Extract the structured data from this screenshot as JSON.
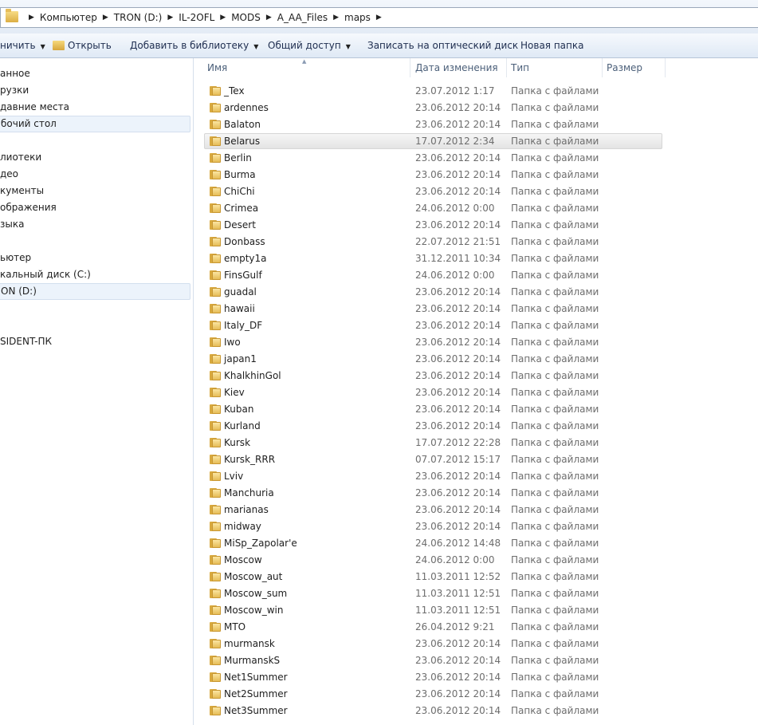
{
  "address_bar": {
    "crumbs": [
      "Компьютер",
      "TRON (D:)",
      "IL-2OFL",
      "MODS",
      "A_AA_Files",
      "maps"
    ]
  },
  "toolbar": {
    "organize": "ничить",
    "open": "Открыть",
    "add_to_library": "Добавить в библиотеку",
    "share": "Общий доступ",
    "burn": "Записать на оптический диск",
    "new_folder": "Новая папка"
  },
  "nav": {
    "items": [
      "анное",
      "рузки",
      "давние места",
      "бочий стол",
      "лиотеки",
      "део",
      "кументы",
      "ображения",
      "зыка",
      "ьютер",
      "кальный диск (C:)",
      "ON (D:)",
      "SIDENT-ПК"
    ]
  },
  "columns": {
    "name": "Имя",
    "date": "Дата изменения",
    "type": "Тип",
    "size": "Размер"
  },
  "files": [
    {
      "name": "_Tex",
      "date": "23.07.2012 1:17",
      "type": "Папка с файлами"
    },
    {
      "name": "ardennes",
      "date": "23.06.2012 20:14",
      "type": "Папка с файлами"
    },
    {
      "name": "Balaton",
      "date": "23.06.2012 20:14",
      "type": "Папка с файлами"
    },
    {
      "name": "Belarus",
      "date": "17.07.2012 2:34",
      "type": "Папка с файлами"
    },
    {
      "name": "Berlin",
      "date": "23.06.2012 20:14",
      "type": "Папка с файлами"
    },
    {
      "name": "Burma",
      "date": "23.06.2012 20:14",
      "type": "Папка с файлами"
    },
    {
      "name": "ChiChi",
      "date": "23.06.2012 20:14",
      "type": "Папка с файлами"
    },
    {
      "name": "Crimea",
      "date": "24.06.2012 0:00",
      "type": "Папка с файлами"
    },
    {
      "name": "Desert",
      "date": "23.06.2012 20:14",
      "type": "Папка с файлами"
    },
    {
      "name": "Donbass",
      "date": "22.07.2012 21:51",
      "type": "Папка с файлами"
    },
    {
      "name": "empty1a",
      "date": "31.12.2011 10:34",
      "type": "Папка с файлами"
    },
    {
      "name": "FinsGulf",
      "date": "24.06.2012 0:00",
      "type": "Папка с файлами"
    },
    {
      "name": "guadal",
      "date": "23.06.2012 20:14",
      "type": "Папка с файлами"
    },
    {
      "name": "hawaii",
      "date": "23.06.2012 20:14",
      "type": "Папка с файлами"
    },
    {
      "name": "Italy_DF",
      "date": "23.06.2012 20:14",
      "type": "Папка с файлами"
    },
    {
      "name": "Iwo",
      "date": "23.06.2012 20:14",
      "type": "Папка с файлами"
    },
    {
      "name": "japan1",
      "date": "23.06.2012 20:14",
      "type": "Папка с файлами"
    },
    {
      "name": "KhalkhinGol",
      "date": "23.06.2012 20:14",
      "type": "Папка с файлами"
    },
    {
      "name": "Kiev",
      "date": "23.06.2012 20:14",
      "type": "Папка с файлами"
    },
    {
      "name": "Kuban",
      "date": "23.06.2012 20:14",
      "type": "Папка с файлами"
    },
    {
      "name": "Kurland",
      "date": "23.06.2012 20:14",
      "type": "Папка с файлами"
    },
    {
      "name": "Kursk",
      "date": "17.07.2012 22:28",
      "type": "Папка с файлами"
    },
    {
      "name": "Kursk_RRR",
      "date": "07.07.2012 15:17",
      "type": "Папка с файлами"
    },
    {
      "name": "Lviv",
      "date": "23.06.2012 20:14",
      "type": "Папка с файлами"
    },
    {
      "name": "Manchuria",
      "date": "23.06.2012 20:14",
      "type": "Папка с файлами"
    },
    {
      "name": "marianas",
      "date": "23.06.2012 20:14",
      "type": "Папка с файлами"
    },
    {
      "name": "midway",
      "date": "23.06.2012 20:14",
      "type": "Папка с файлами"
    },
    {
      "name": "MiSp_Zapolar'e",
      "date": "24.06.2012 14:48",
      "type": "Папка с файлами"
    },
    {
      "name": "Moscow",
      "date": "24.06.2012 0:00",
      "type": "Папка с файлами"
    },
    {
      "name": "Moscow_aut",
      "date": "11.03.2011 12:52",
      "type": "Папка с файлами"
    },
    {
      "name": "Moscow_sum",
      "date": "11.03.2011 12:51",
      "type": "Папка с файлами"
    },
    {
      "name": "Moscow_win",
      "date": "11.03.2011 12:51",
      "type": "Папка с файлами"
    },
    {
      "name": "MTO",
      "date": "26.04.2012 9:21",
      "type": "Папка с файлами"
    },
    {
      "name": "murmansk",
      "date": "23.06.2012 20:14",
      "type": "Папка с файлами"
    },
    {
      "name": "MurmanskS",
      "date": "23.06.2012 20:14",
      "type": "Папка с файлами"
    },
    {
      "name": "Net1Summer",
      "date": "23.06.2012 20:14",
      "type": "Папка с файлами"
    },
    {
      "name": "Net2Summer",
      "date": "23.06.2012 20:14",
      "type": "Папка с файлами"
    },
    {
      "name": "Net3Summer",
      "date": "23.06.2012 20:14",
      "type": "Папка с файлами"
    }
  ],
  "selected_file": "Belarus"
}
